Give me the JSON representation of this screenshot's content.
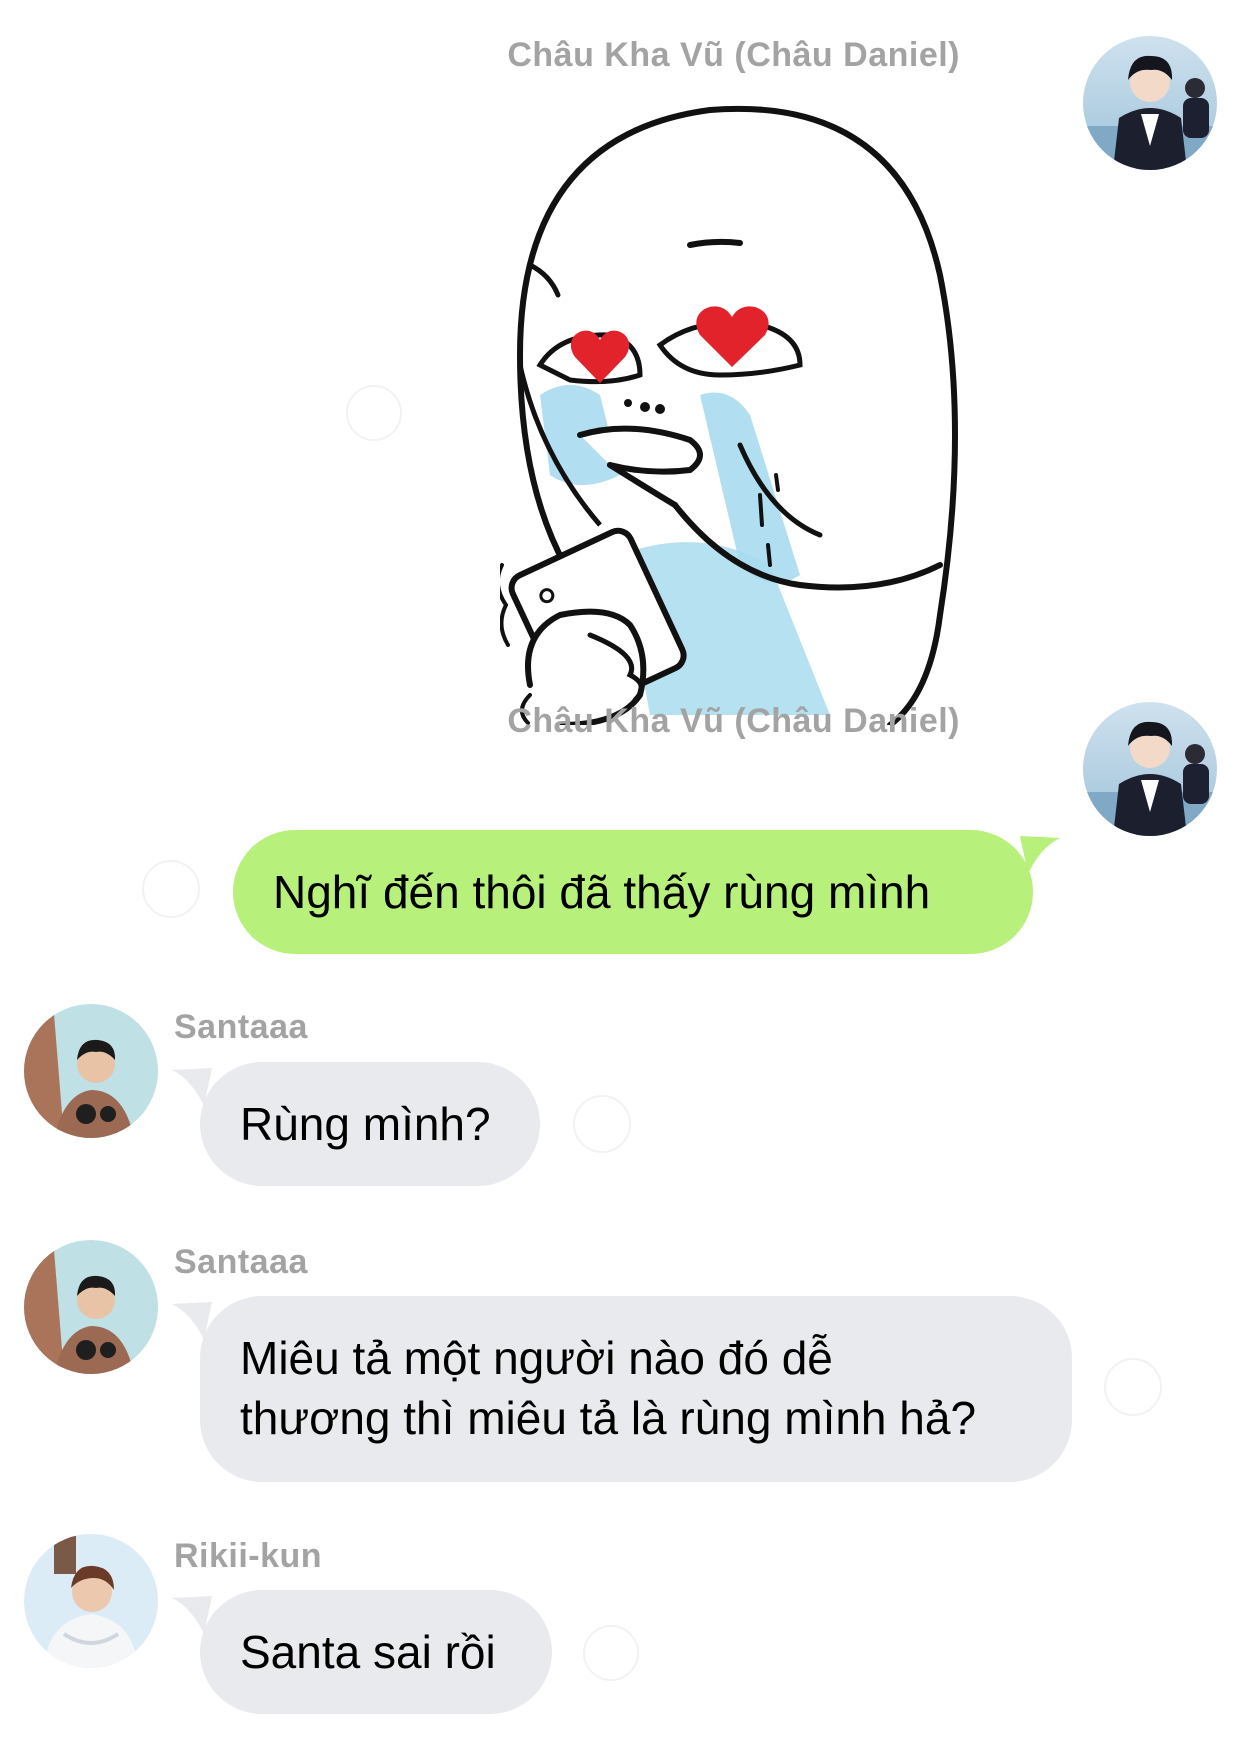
{
  "messages": [
    {
      "id": "m1",
      "sender": "Châu Kha Vũ (Châu Daniel)",
      "side": "right",
      "kind": "sticker",
      "sticker": "crying-heart-eyes-phone-sticker"
    },
    {
      "id": "m2",
      "sender": "Châu Kha Vũ (Châu Daniel)",
      "side": "right",
      "kind": "text",
      "text": "Nghĩ đến thôi đã thấy rùng mình"
    },
    {
      "id": "m3",
      "sender": "Santaaa",
      "side": "left",
      "kind": "text",
      "text": "Rùng mình?"
    },
    {
      "id": "m4",
      "sender": "Santaaa",
      "side": "left",
      "kind": "text",
      "line1": "Miêu tả một người nào đó dễ",
      "line2": "thương thì miêu tả là rùng mình hả?"
    },
    {
      "id": "m5",
      "sender": "Rikii-kun",
      "side": "left",
      "kind": "text",
      "text": "Santa sai rồi"
    }
  ],
  "colors": {
    "outgoing_bubble": "#b8f07c",
    "incoming_bubble": "#e9eaed",
    "sender_name": "#a3a3a3",
    "heart": "#e3232c",
    "tears": "#a8dcef"
  },
  "icons": {
    "avatar_chau": "avatar-chau-kha-vu",
    "avatar_santa": "avatar-santaaa",
    "avatar_riki": "avatar-rikii-kun"
  }
}
